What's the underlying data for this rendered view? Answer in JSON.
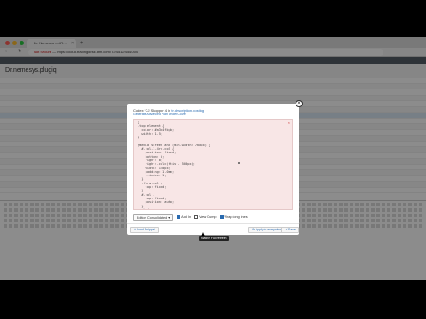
{
  "browser": {
    "tab_title": "Dr. Nemesys — tR…",
    "tab_close": "×",
    "tab_add": "+",
    "nav_glyphs": "‹ › ↻",
    "not_secure": "Not Secure",
    "url": "— https://cloud.tradingdesk.ibm.com/T2/4512/45/1000"
  },
  "app": {
    "bar_text": "",
    "page_title": "Dr.nemesys.plugiq"
  },
  "modal": {
    "title_prefix": "Codex ‘CJ Shopper 4 in ",
    "title_link": "tr.description.posting",
    "subtitle": "Generate Advanced Plan Under Cover",
    "close_glyph": "×",
    "code_close": "×",
    "code_text": "{\n.top.element {\n  color: #a3d4fb/b;\n  width: 1.5;\n}\n\n@media screen and (min-width: 768px) {\n  #.col-1.4rr.col {\n    position: fixed;\n    bottom: 0;\n    right: 0;\n    right:-calc(ttiv - 500px);\n    width: 150px;\n    padding: 1.0em;\n    z-index: 1;\n  }\n  .form.col {\n    top: fixed;\n  }\n  #.col {\n    top: fixed;\n    position: auto;\n  }\n  .body {\n    padding-left: 1.0em;\n    padding-right: 0.5em;\n  }\n}",
    "select_value": "Editor: Consolidated ▾",
    "checkbox_add_in": "Add In",
    "checkbox_view_dump": "View Dump",
    "checkbox_wrap": "Wrap long lines",
    "btn_left": "+ Load Snippet",
    "btn_apply": "⟳ Apply to everywhere",
    "btn_save": "✓ Save"
  },
  "tooltip": "Native Full refresh",
  "colors": {
    "accent": "#2a6bb0",
    "code_bg": "#f8e6e6",
    "overlay": "rgba(0,0,0,0.45)"
  }
}
